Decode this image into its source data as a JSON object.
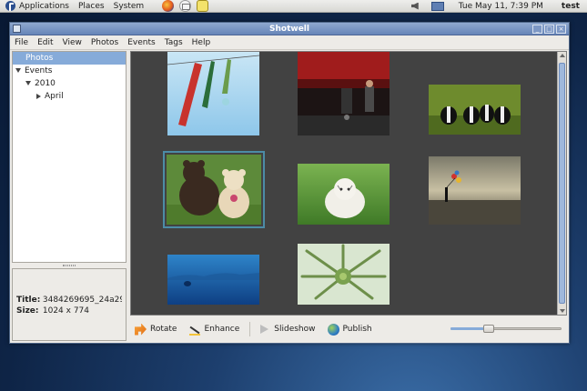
{
  "panel": {
    "menus": [
      "Applications",
      "Places",
      "System"
    ],
    "clock": "Tue May 11,  7:39 PM",
    "user": "test"
  },
  "window": {
    "title": "Shotwell",
    "controls": [
      "_",
      "□",
      "×"
    ]
  },
  "menubar": [
    "File",
    "Edit",
    "View",
    "Photos",
    "Events",
    "Tags",
    "Help"
  ],
  "sidebar": {
    "items": [
      {
        "label": "Photos",
        "selected": true
      },
      {
        "label": "Events"
      },
      {
        "label": "2010"
      },
      {
        "label": "April"
      }
    ]
  },
  "properties": {
    "title_key": "Title:",
    "title_value": "3484269695_24a29...",
    "size_key": "Size:",
    "size_value": "1024 x 774"
  },
  "toolbar": {
    "rotate": "Rotate",
    "enhance": "Enhance",
    "slideshow": "Slideshow",
    "publish": "Publish",
    "zoom_fraction": 0.33
  },
  "photos": [
    {
      "name": "kites-photo",
      "selected": false
    },
    {
      "name": "stroller-photo",
      "selected": false
    },
    {
      "name": "skunks-photo",
      "selected": false
    },
    {
      "name": "bear-and-teddy-photo",
      "selected": true
    },
    {
      "name": "white-tiger-cub-photo",
      "selected": false
    },
    {
      "name": "balloons-photo",
      "selected": false
    },
    {
      "name": "blue-lake-photo",
      "selected": false
    },
    {
      "name": "flower-photo",
      "selected": false
    }
  ]
}
